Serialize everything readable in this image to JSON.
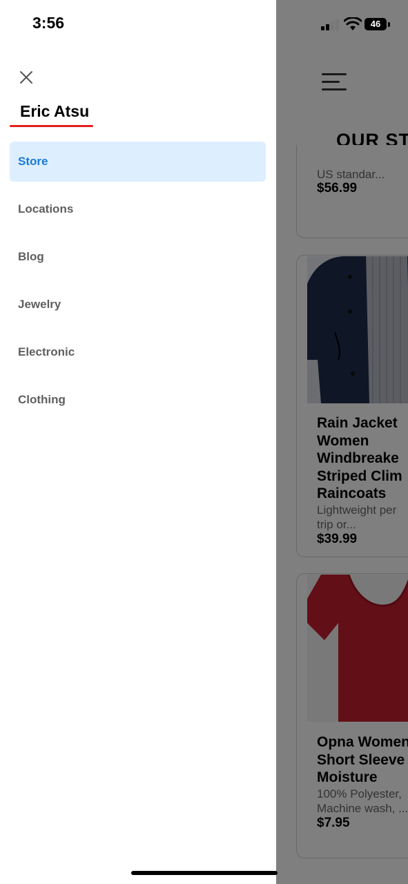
{
  "status_bar": {
    "time": "3:56",
    "battery": "46"
  },
  "drawer": {
    "user_name": "Eric Atsu",
    "items": [
      {
        "label": "Store",
        "active": true
      },
      {
        "label": "Locations",
        "active": false
      },
      {
        "label": "Blog",
        "active": false
      },
      {
        "label": "Jewelry",
        "active": false
      },
      {
        "label": "Electronic",
        "active": false
      },
      {
        "label": "Clothing",
        "active": false
      }
    ]
  },
  "background": {
    "page_title": "OUR ST",
    "products": [
      {
        "desc_lines": [
          "US standar..."
        ],
        "price": "$56.99"
      },
      {
        "title_lines": [
          "Rain Jacket",
          "Women",
          "Windbreake",
          "Striped Clim",
          "Raincoats"
        ],
        "desc_lines": [
          "Lightweight per",
          "trip or..."
        ],
        "price": "$39.99"
      },
      {
        "title_lines": [
          "Opna Women",
          "Short Sleeve",
          "Moisture"
        ],
        "desc_lines": [
          "100% Polyester,",
          "Machine wash, ..."
        ],
        "price": "$7.95"
      }
    ]
  },
  "colors": {
    "accent": "#1a7ad6",
    "active_bg": "#ddeeff",
    "underline": "#e41e1e",
    "scrim": "rgba(0,0,0,0.5)"
  }
}
